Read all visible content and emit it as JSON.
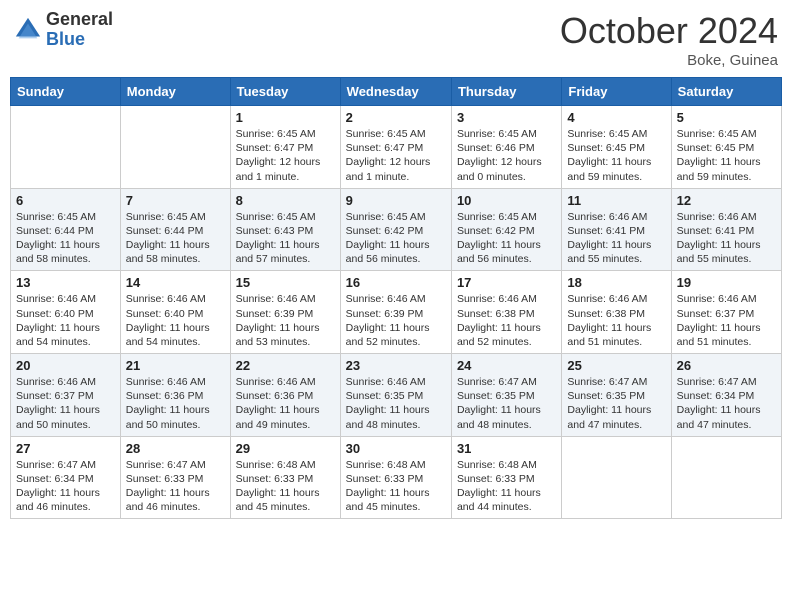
{
  "logo": {
    "general": "General",
    "blue": "Blue"
  },
  "title": "October 2024",
  "location": "Boke, Guinea",
  "days_of_week": [
    "Sunday",
    "Monday",
    "Tuesday",
    "Wednesday",
    "Thursday",
    "Friday",
    "Saturday"
  ],
  "weeks": [
    [
      {
        "day": "",
        "info": ""
      },
      {
        "day": "",
        "info": ""
      },
      {
        "day": "1",
        "info": "Sunrise: 6:45 AM\nSunset: 6:47 PM\nDaylight: 12 hours and 1 minute."
      },
      {
        "day": "2",
        "info": "Sunrise: 6:45 AM\nSunset: 6:47 PM\nDaylight: 12 hours and 1 minute."
      },
      {
        "day": "3",
        "info": "Sunrise: 6:45 AM\nSunset: 6:46 PM\nDaylight: 12 hours and 0 minutes."
      },
      {
        "day": "4",
        "info": "Sunrise: 6:45 AM\nSunset: 6:45 PM\nDaylight: 11 hours and 59 minutes."
      },
      {
        "day": "5",
        "info": "Sunrise: 6:45 AM\nSunset: 6:45 PM\nDaylight: 11 hours and 59 minutes."
      }
    ],
    [
      {
        "day": "6",
        "info": "Sunrise: 6:45 AM\nSunset: 6:44 PM\nDaylight: 11 hours and 58 minutes."
      },
      {
        "day": "7",
        "info": "Sunrise: 6:45 AM\nSunset: 6:44 PM\nDaylight: 11 hours and 58 minutes."
      },
      {
        "day": "8",
        "info": "Sunrise: 6:45 AM\nSunset: 6:43 PM\nDaylight: 11 hours and 57 minutes."
      },
      {
        "day": "9",
        "info": "Sunrise: 6:45 AM\nSunset: 6:42 PM\nDaylight: 11 hours and 56 minutes."
      },
      {
        "day": "10",
        "info": "Sunrise: 6:45 AM\nSunset: 6:42 PM\nDaylight: 11 hours and 56 minutes."
      },
      {
        "day": "11",
        "info": "Sunrise: 6:46 AM\nSunset: 6:41 PM\nDaylight: 11 hours and 55 minutes."
      },
      {
        "day": "12",
        "info": "Sunrise: 6:46 AM\nSunset: 6:41 PM\nDaylight: 11 hours and 55 minutes."
      }
    ],
    [
      {
        "day": "13",
        "info": "Sunrise: 6:46 AM\nSunset: 6:40 PM\nDaylight: 11 hours and 54 minutes."
      },
      {
        "day": "14",
        "info": "Sunrise: 6:46 AM\nSunset: 6:40 PM\nDaylight: 11 hours and 54 minutes."
      },
      {
        "day": "15",
        "info": "Sunrise: 6:46 AM\nSunset: 6:39 PM\nDaylight: 11 hours and 53 minutes."
      },
      {
        "day": "16",
        "info": "Sunrise: 6:46 AM\nSunset: 6:39 PM\nDaylight: 11 hours and 52 minutes."
      },
      {
        "day": "17",
        "info": "Sunrise: 6:46 AM\nSunset: 6:38 PM\nDaylight: 11 hours and 52 minutes."
      },
      {
        "day": "18",
        "info": "Sunrise: 6:46 AM\nSunset: 6:38 PM\nDaylight: 11 hours and 51 minutes."
      },
      {
        "day": "19",
        "info": "Sunrise: 6:46 AM\nSunset: 6:37 PM\nDaylight: 11 hours and 51 minutes."
      }
    ],
    [
      {
        "day": "20",
        "info": "Sunrise: 6:46 AM\nSunset: 6:37 PM\nDaylight: 11 hours and 50 minutes."
      },
      {
        "day": "21",
        "info": "Sunrise: 6:46 AM\nSunset: 6:36 PM\nDaylight: 11 hours and 50 minutes."
      },
      {
        "day": "22",
        "info": "Sunrise: 6:46 AM\nSunset: 6:36 PM\nDaylight: 11 hours and 49 minutes."
      },
      {
        "day": "23",
        "info": "Sunrise: 6:46 AM\nSunset: 6:35 PM\nDaylight: 11 hours and 48 minutes."
      },
      {
        "day": "24",
        "info": "Sunrise: 6:47 AM\nSunset: 6:35 PM\nDaylight: 11 hours and 48 minutes."
      },
      {
        "day": "25",
        "info": "Sunrise: 6:47 AM\nSunset: 6:35 PM\nDaylight: 11 hours and 47 minutes."
      },
      {
        "day": "26",
        "info": "Sunrise: 6:47 AM\nSunset: 6:34 PM\nDaylight: 11 hours and 47 minutes."
      }
    ],
    [
      {
        "day": "27",
        "info": "Sunrise: 6:47 AM\nSunset: 6:34 PM\nDaylight: 11 hours and 46 minutes."
      },
      {
        "day": "28",
        "info": "Sunrise: 6:47 AM\nSunset: 6:33 PM\nDaylight: 11 hours and 46 minutes."
      },
      {
        "day": "29",
        "info": "Sunrise: 6:48 AM\nSunset: 6:33 PM\nDaylight: 11 hours and 45 minutes."
      },
      {
        "day": "30",
        "info": "Sunrise: 6:48 AM\nSunset: 6:33 PM\nDaylight: 11 hours and 45 minutes."
      },
      {
        "day": "31",
        "info": "Sunrise: 6:48 AM\nSunset: 6:33 PM\nDaylight: 11 hours and 44 minutes."
      },
      {
        "day": "",
        "info": ""
      },
      {
        "day": "",
        "info": ""
      }
    ]
  ]
}
